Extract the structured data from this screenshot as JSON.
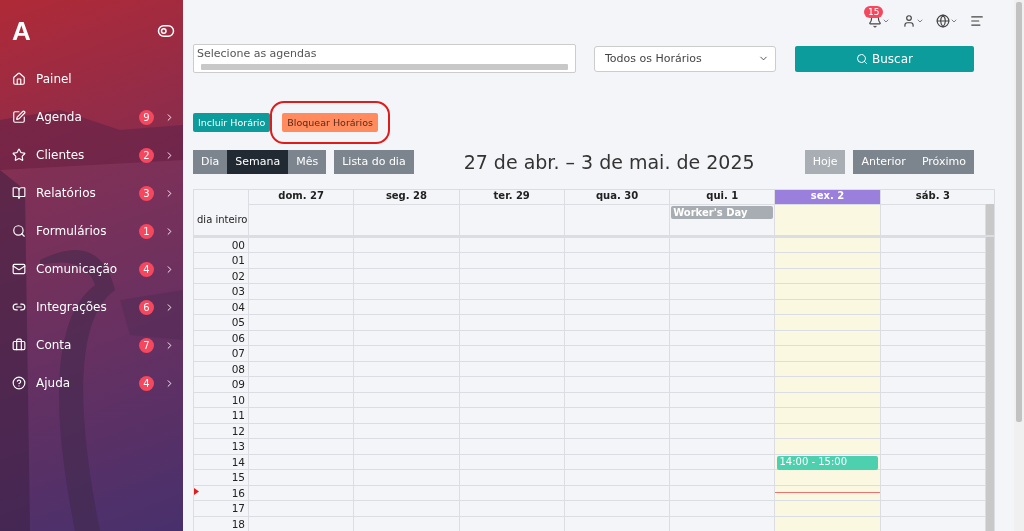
{
  "sidebar": {
    "logo": "A",
    "items": [
      {
        "label": "Painel"
      },
      {
        "label": "Agenda",
        "badge": "9"
      },
      {
        "label": "Clientes",
        "badge": "2"
      },
      {
        "label": "Relatórios",
        "badge": "3"
      },
      {
        "label": "Formulários",
        "badge": "1"
      },
      {
        "label": "Comunicação",
        "badge": "4"
      },
      {
        "label": "Integrações",
        "badge": "6"
      },
      {
        "label": "Conta",
        "badge": "7"
      },
      {
        "label": "Ajuda",
        "badge": "4"
      }
    ]
  },
  "topbar": {
    "notifications": "15"
  },
  "filters": {
    "agendas": {
      "placeholder": "Selecione as agendas"
    },
    "hours": {
      "value": "Todos os Horários"
    },
    "search_button": "Buscar"
  },
  "actions": [
    {
      "label": "Incluir Horário",
      "kind": "primary",
      "highlighted": false
    },
    {
      "label": "Bloquear Horários",
      "kind": "warning",
      "highlighted": true
    }
  ],
  "calendar": {
    "views": [
      {
        "label": "Dia",
        "selected": false
      },
      {
        "label": "Semana",
        "selected": true
      },
      {
        "label": "Mês",
        "selected": false
      }
    ],
    "list_button": "Lista do dia",
    "title": "27 de abr. – 3 de mai. de 2025",
    "today_button": "Hoje",
    "prev_button": "Anterior",
    "next_button": "Próximo",
    "allday_label": "dia inteiro",
    "days": [
      {
        "label": "dom. 27",
        "today": false
      },
      {
        "label": "seg. 28",
        "today": false
      },
      {
        "label": "ter. 29",
        "today": false
      },
      {
        "label": "qua. 30",
        "today": false
      },
      {
        "label": "qui. 1",
        "today": false,
        "allday_event": "Worker's Day"
      },
      {
        "label": "sex. 2",
        "today": true
      },
      {
        "label": "sáb. 3",
        "today": false
      }
    ],
    "hours": [
      {
        "label": "00",
        "now": false
      },
      {
        "label": "01",
        "now": false
      },
      {
        "label": "02",
        "now": false
      },
      {
        "label": "03",
        "now": false
      },
      {
        "label": "04",
        "now": false
      },
      {
        "label": "05",
        "now": false
      },
      {
        "label": "06",
        "now": false
      },
      {
        "label": "07",
        "now": false
      },
      {
        "label": "08",
        "now": false
      },
      {
        "label": "09",
        "now": false
      },
      {
        "label": "10",
        "now": false
      },
      {
        "label": "11",
        "now": false
      },
      {
        "label": "12",
        "now": false
      },
      {
        "label": "13",
        "now": false
      },
      {
        "label": "14",
        "now": false,
        "today_event": "14:00 - 15:00"
      },
      {
        "label": "15",
        "now": false
      },
      {
        "label": "16",
        "now": true
      },
      {
        "label": "17",
        "now": false
      },
      {
        "label": "18",
        "now": false
      }
    ]
  }
}
